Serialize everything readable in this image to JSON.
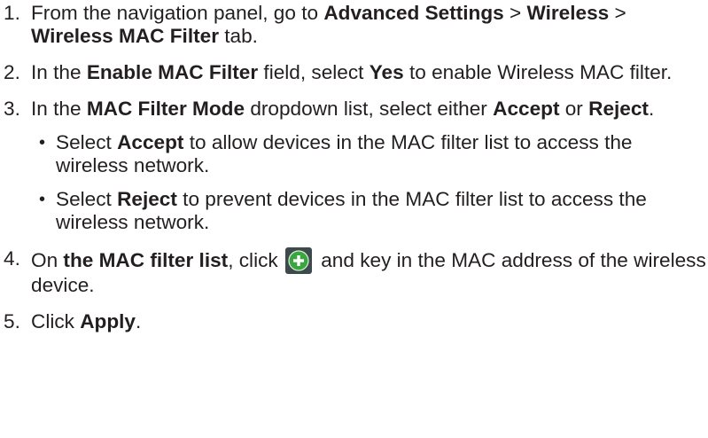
{
  "steps": [
    {
      "number": "1.",
      "parts": [
        {
          "text": "From the navigation panel, go to ",
          "bold": false
        },
        {
          "text": "Advanced Settings",
          "bold": true
        },
        {
          "text": " > ",
          "bold": false
        },
        {
          "text": "Wireless",
          "bold": true
        },
        {
          "text": " > ",
          "bold": false
        },
        {
          "text": "Wireless MAC Filter",
          "bold": true
        },
        {
          "text": " tab.",
          "bold": false
        }
      ]
    },
    {
      "number": "2.",
      "parts": [
        {
          "text": "In the ",
          "bold": false
        },
        {
          "text": "Enable MAC Filter",
          "bold": true
        },
        {
          "text": " field, select ",
          "bold": false
        },
        {
          "text": "Yes",
          "bold": true
        },
        {
          "text": " to enable Wireless MAC filter.",
          "bold": false
        }
      ]
    },
    {
      "number": "3.",
      "parts": [
        {
          "text": "In the ",
          "bold": false
        },
        {
          "text": "MAC Filter Mode",
          "bold": true
        },
        {
          "text": " dropdown list, select either ",
          "bold": false
        },
        {
          "text": "Accept",
          "bold": true
        },
        {
          "text": " or ",
          "bold": false
        },
        {
          "text": "Reject",
          "bold": true
        },
        {
          "text": ".",
          "bold": false
        }
      ],
      "sub_items": [
        {
          "bullet": "•",
          "parts": [
            {
              "text": "Select ",
              "bold": false
            },
            {
              "text": "Accept",
              "bold": true
            },
            {
              "text": " to allow devices in the MAC filter list to access the wireless network.",
              "bold": false
            }
          ]
        },
        {
          "bullet": "•",
          "parts": [
            {
              "text": "Select ",
              "bold": false
            },
            {
              "text": "Reject",
              "bold": true
            },
            {
              "text": " to prevent devices in the MAC filter list to access the wireless network.",
              "bold": false
            }
          ]
        }
      ]
    },
    {
      "number": "4.",
      "parts": [
        {
          "text": "On ",
          "bold": false
        },
        {
          "text": "the MAC filter list",
          "bold": true
        },
        {
          "text": ", click ",
          "bold": false
        },
        {
          "icon": "add-circle-icon"
        },
        {
          "text": " and key in the MAC address of the wireless device.",
          "bold": false
        }
      ]
    },
    {
      "number": "5.",
      "parts": [
        {
          "text": "Click ",
          "bold": false
        },
        {
          "text": "Apply",
          "bold": true
        },
        {
          "text": ".",
          "bold": false
        }
      ]
    }
  ],
  "icons": {
    "add-circle-icon": {
      "name": "add-circle-icon",
      "ring_color": "#3d4a4c",
      "fill_color": "#3aa63f",
      "symbol_color": "#ffffff"
    }
  }
}
